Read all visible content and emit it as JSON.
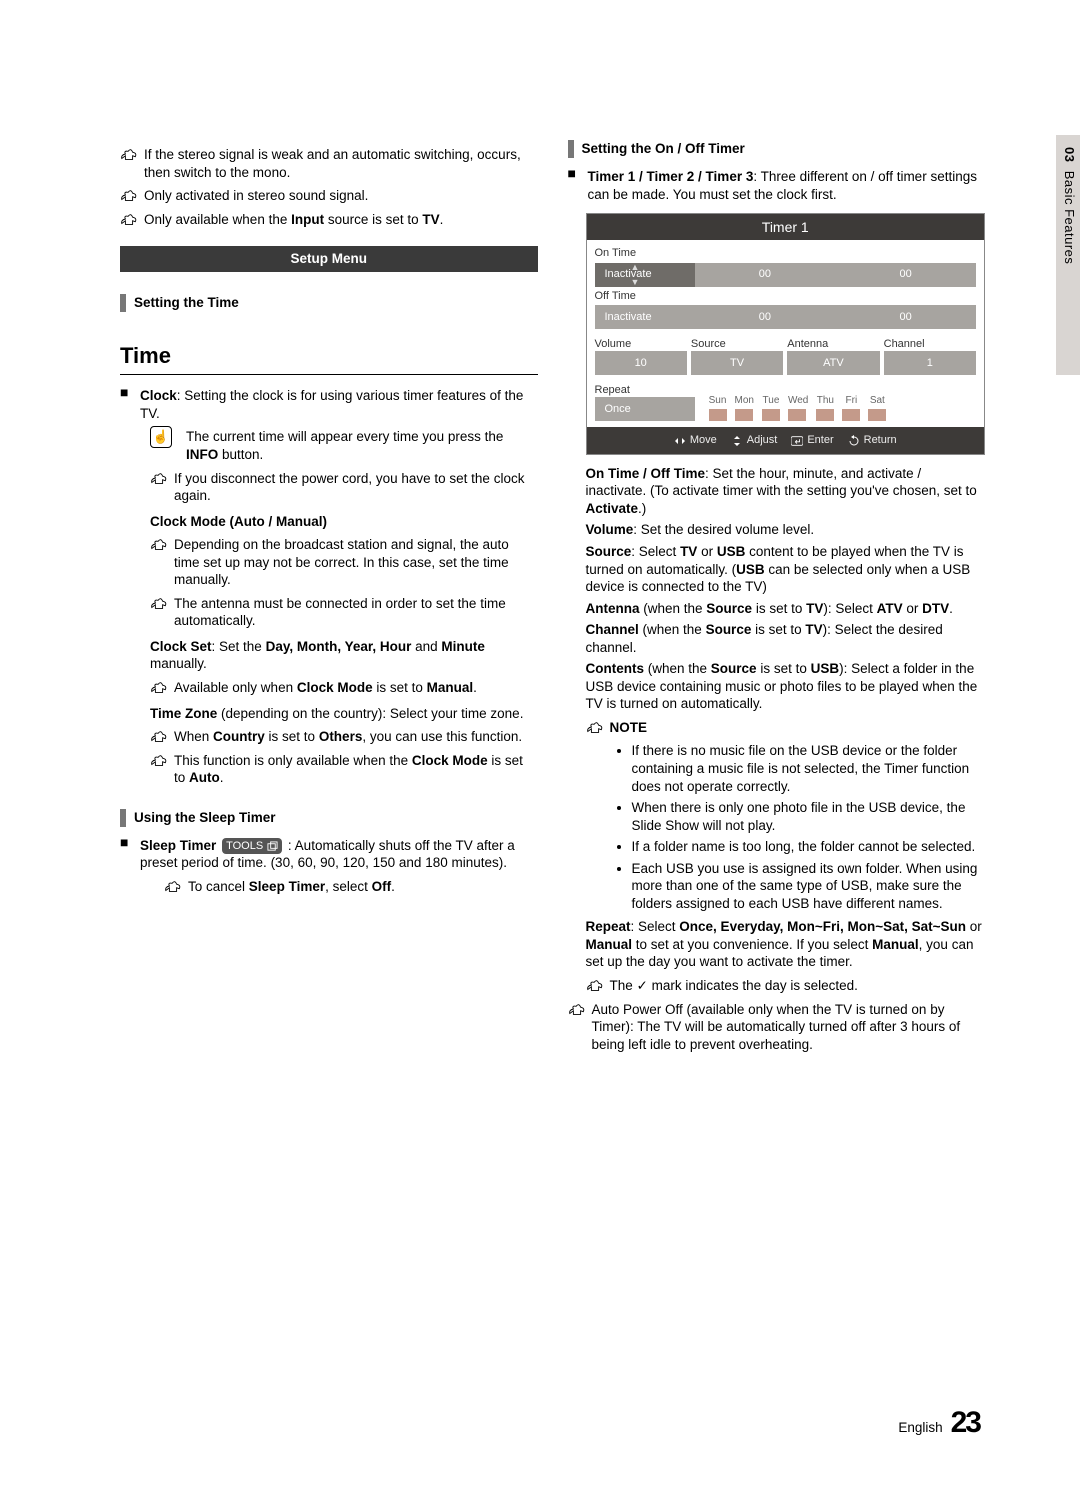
{
  "sidetab": {
    "chapter": "03",
    "section": "Basic Features"
  },
  "col1": {
    "n1": "If the stereo signal is weak and an automatic switching, occurs, then switch to the mono.",
    "n2": "Only activated in stereo sound signal.",
    "n3_pre": "Only available when the ",
    "n3_b1": "Input",
    "n3_mid": " source is set to ",
    "n3_b2": "TV",
    "n3_post": ".",
    "setup_menu": "Setup Menu",
    "h_time": "Setting the Time",
    "title_time": "Time",
    "clock_label": "Clock",
    "clock_text": ": Setting the clock is for using various timer features of the TV.",
    "hand_text_pre": "The current time will appear every time you press the ",
    "hand_b": "INFO",
    "hand_post": " button.",
    "c_n1": "If you disconnect the power cord, you have to set the clock again.",
    "clock_mode_label": "Clock Mode (Auto / Manual)",
    "cm_n1": "Depending on the broadcast station and signal, the auto time set up may not be correct. In this case, set the time manually.",
    "cm_n2": "The antenna must be connected in order to set the time automatically.",
    "clockset_label": "Clock Set",
    "clockset_pre": ": Set the ",
    "clockset_b": "Day, Month, Year, Hour",
    "clockset_and": " and ",
    "clockset_min": "Minute",
    "clockset_post": " manually.",
    "cs_n1_pre": "Available only when ",
    "cs_n1_b": "Clock Mode",
    "cs_n1_mid": " is set to ",
    "cs_n1_man": "Manual",
    "cs_n1_post": ".",
    "tz_label": "Time Zone",
    "tz_text": " (depending on the country): Select your time zone.",
    "tz_n1_pre": "When ",
    "tz_n1_b1": "Country",
    "tz_n1_mid": " is set to ",
    "tz_n1_b2": "Others",
    "tz_n1_post": ", you can use this function.",
    "tz_n2_pre": "This function is only available when the ",
    "tz_n2_b1": "Clock Mode",
    "tz_n2_mid": " is set to ",
    "tz_n2_b2": "Auto",
    "tz_n2_post": ".",
    "h_sleep": "Using the Sleep Timer",
    "sleep_label": "Sleep Timer",
    "tools_label": "TOOLS",
    "sleep_text": ": Automatically shuts off the TV after a preset period of time. (30, 60, 90, 120, 150 and 180 minutes).",
    "sleep_n_pre": "To cancel ",
    "sleep_n_b1": "Sleep Timer",
    "sleep_n_mid": ", select ",
    "sleep_n_b2": "Off",
    "sleep_n_post": "."
  },
  "col2": {
    "h_onoff": "Setting the On / Off Timer",
    "timer_label": "Timer 1 / Timer 2 / Timer 3",
    "timer_text": ": Three different on / off timer settings can be made. You must set the clock first.",
    "ontime_label": "On Time / Off Time",
    "ontime_text": ": Set the hour, minute, and activate / inactivate. (To activate timer with the setting you've chosen, set to ",
    "ontime_b": "Activate",
    "ontime_post": ".)",
    "vol_label": "Volume",
    "vol_text": ": Set the desired volume level.",
    "src_label": "Source",
    "src_pre": ": Select ",
    "src_b1": "TV",
    "src_or": " or ",
    "src_b2": "USB",
    "src_text": " content to be played when the TV is turned on automatically. (",
    "src_b3": "USB",
    "src_text2": " can be selected only when a USB device is connected to the TV)",
    "ant_label": "Antenna",
    "ant_pre": " (when the ",
    "ant_b1": "Source",
    "ant_mid": " is set to ",
    "ant_b2": "TV",
    "ant_post": "): Select ",
    "ant_b3": "ATV",
    "ant_or": " or ",
    "ant_b4": "DTV",
    "ant_post2": ".",
    "ch_label": "Channel",
    "ch_pre": " (when the ",
    "ch_b1": "Source",
    "ch_mid": " is set to ",
    "ch_b2": "TV",
    "ch_post": "): Select the desired channel.",
    "con_label": "Contents",
    "con_pre": " (when the ",
    "con_b1": "Source",
    "con_mid": " is set to ",
    "con_b2": "USB",
    "con_post": "): Select a folder in the USB device containing music or photo files to be played when the TV is turned on automatically.",
    "note_word": "NOTE",
    "li1": "If there is no music file on the USB device or the folder containing a music file is not selected, the Timer function does not operate correctly.",
    "li2": "When there is only one photo file in the USB device, the Slide Show will not play.",
    "li3": "If a folder name is too long, the folder cannot be selected.",
    "li4": "Each USB you use is assigned its own folder. When using more than one of the same type of USB, make sure the folders assigned to each USB have different names.",
    "rep_label": "Repeat",
    "rep_pre": ": Select ",
    "rep_b": "Once, Everyday, Mon~Fri, Mon~Sat, Sat~Sun",
    "rep_or": " or ",
    "rep_b2": "Manual",
    "rep_mid": " to set at you convenience. If you select ",
    "rep_b3": "Manual",
    "rep_post": ", you can set up the day you want to activate the timer.",
    "check_text": "The ✓ mark indicates the day is selected.",
    "apo_text": "Auto Power Off (available only when the TV is turned on by Timer): The TV will be automatically turned off after 3 hours of being left idle to prevent overheating."
  },
  "timer": {
    "title": "Timer 1",
    "on_time": "On Time",
    "off_time": "Off Time",
    "inactivate": "Inactivate",
    "zero": "00",
    "volume": "Volume",
    "source": "Source",
    "antenna": "Antenna",
    "channel": "Channel",
    "v10": "10",
    "tv": "TV",
    "atv": "ATV",
    "one": "1",
    "repeat": "Repeat",
    "once": "Once",
    "days": [
      "Sun",
      "Mon",
      "Tue",
      "Wed",
      "Thu",
      "Fri",
      "Sat"
    ],
    "move": "Move",
    "adjust": "Adjust",
    "enter": "Enter",
    "return": "Return"
  },
  "footer": {
    "lang": "English",
    "page": "23"
  }
}
